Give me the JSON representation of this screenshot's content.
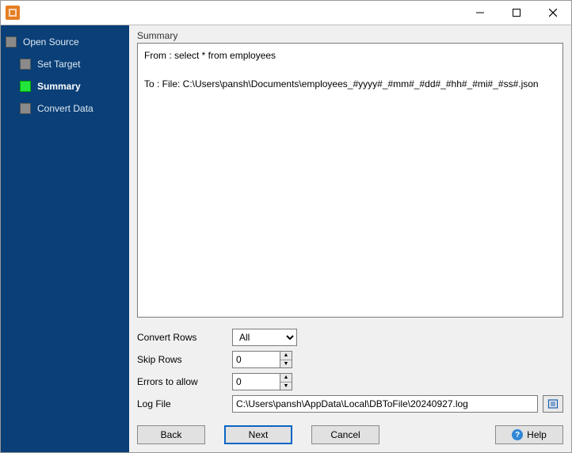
{
  "titlebar": {
    "title": ""
  },
  "sidebar": {
    "root": "Open Source",
    "items": [
      {
        "label": "Set Target",
        "active": false,
        "current": false
      },
      {
        "label": "Summary",
        "active": true,
        "current": true
      },
      {
        "label": "Convert Data",
        "active": false,
        "current": false
      }
    ]
  },
  "summary": {
    "heading": "Summary",
    "from": "From : select * from employees",
    "to": "To : File: C:\\Users\\pansh\\Documents\\employees_#yyyy#_#mm#_#dd#_#hh#_#mi#_#ss#.json"
  },
  "options": {
    "convert_rows_label": "Convert Rows",
    "convert_rows_value": "All",
    "skip_rows_label": "Skip Rows",
    "skip_rows_value": "0",
    "errors_label": "Errors to allow",
    "errors_value": "0",
    "log_label": "Log File",
    "log_value": "C:\\Users\\pansh\\AppData\\Local\\DBToFile\\20240927.log"
  },
  "buttons": {
    "back": "Back",
    "next": "Next",
    "cancel": "Cancel",
    "help": "Help"
  }
}
